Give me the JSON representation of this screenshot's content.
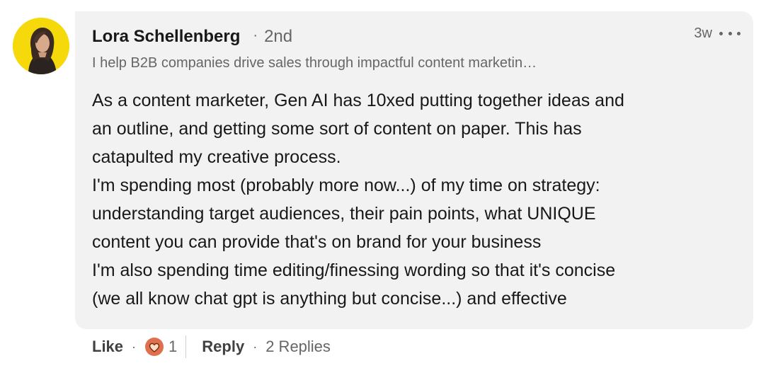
{
  "comment": {
    "author": {
      "name": "Lora Schellenberg",
      "degree": "2nd",
      "headline": "I help B2B companies drive sales through impactful content marketin…"
    },
    "timestamp": "3w",
    "more_icon": "ellipsis-icon",
    "text_lines": [
      "As a content marketer, Gen AI has 10xed putting together ideas and",
      "an outline, and getting some sort of content on paper. This has",
      "catapulted my creative process.",
      "I'm spending most (probably more now...) of my time on strategy:",
      "understanding target audiences, their pain points, what UNIQUE",
      "content you can provide that's on brand for your business",
      "I'm also spending time editing/finessing wording so that it's concise",
      "(we all know chat gpt is anything but concise...) and effective"
    ]
  },
  "actions": {
    "like_label": "Like",
    "reaction_icon": "heart-reaction-icon",
    "reaction_count": "1",
    "reply_label": "Reply",
    "replies_label": "2 Replies",
    "dot": "·"
  },
  "colors": {
    "bubble_bg": "#f2f2f2",
    "avatar_bg": "#f5d90a",
    "reaction_orange": "#df704d",
    "reaction_heart": "#fddec3",
    "meta_gray": "#666666"
  }
}
